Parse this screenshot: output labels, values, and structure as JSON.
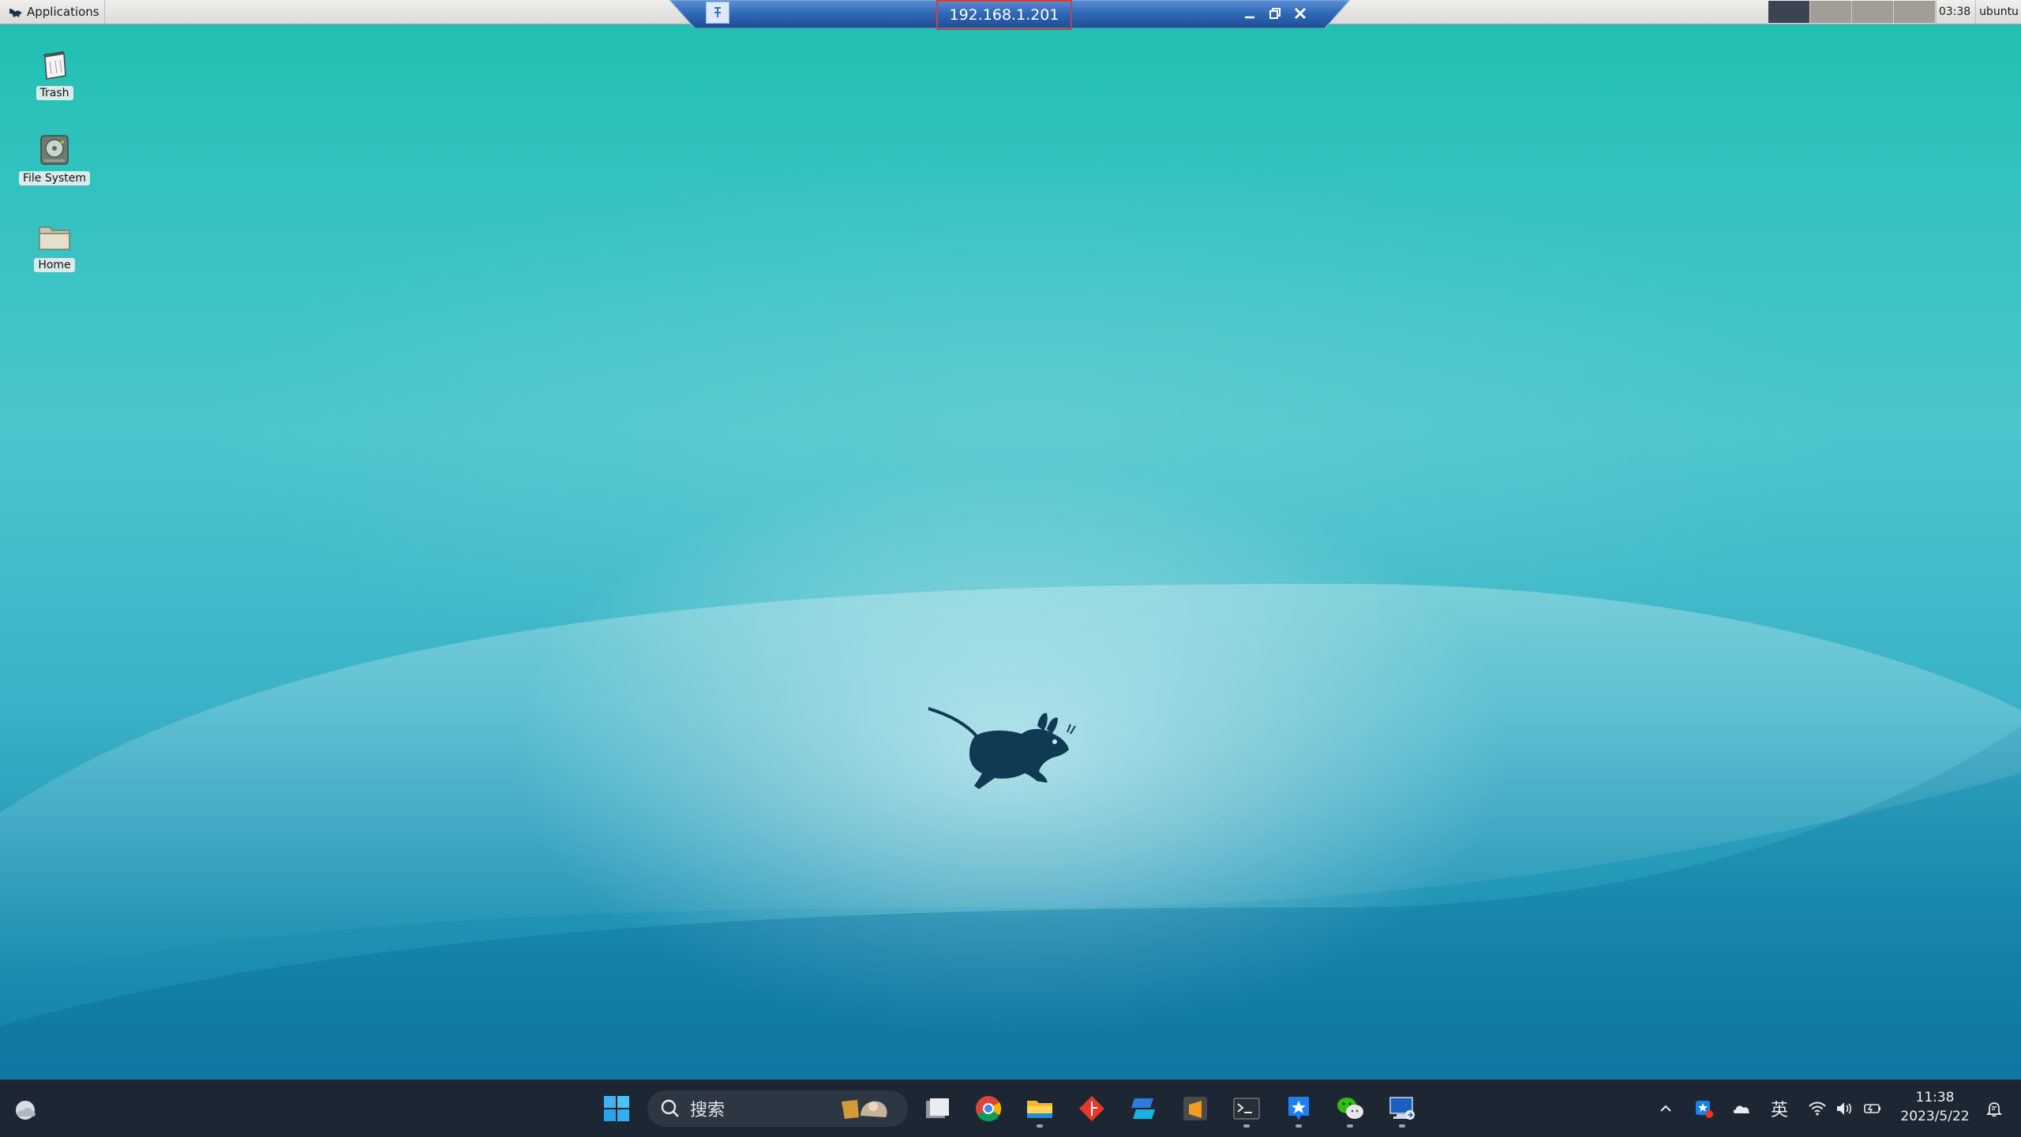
{
  "top_panel": {
    "applications_label": "Applications",
    "clock": "03:38",
    "user": "ubuntu",
    "workspaces": [
      "1",
      "2",
      "3",
      "4"
    ]
  },
  "rdp_bar": {
    "title": "192.168.1.201",
    "highlight_color": "#d93b3b"
  },
  "desktop": {
    "icons": [
      {
        "label": "Trash",
        "icon": "trash-icon"
      },
      {
        "label": "File System",
        "icon": "drive-icon"
      },
      {
        "label": "Home",
        "icon": "folder-icon"
      }
    ]
  },
  "taskbar": {
    "search_placeholder": "搜索",
    "apps": [
      "start-icon",
      "task-view-icon",
      "chrome-icon",
      "file-explorer-icon",
      "git-icon",
      "azure-data-studio-icon",
      "sublime-icon",
      "terminal-icon",
      "app-store-icon",
      "wechat-icon",
      "remote-desktop-icon"
    ],
    "tray": {
      "ime": "英"
    },
    "time": "11:38",
    "date": "2023/5/22"
  },
  "colors": {
    "wallpaper_top": "#1fc0b0",
    "wallpaper_bottom": "#127fa8",
    "taskbar": "#1c2733",
    "rdp_bar": "#2f66b3"
  }
}
